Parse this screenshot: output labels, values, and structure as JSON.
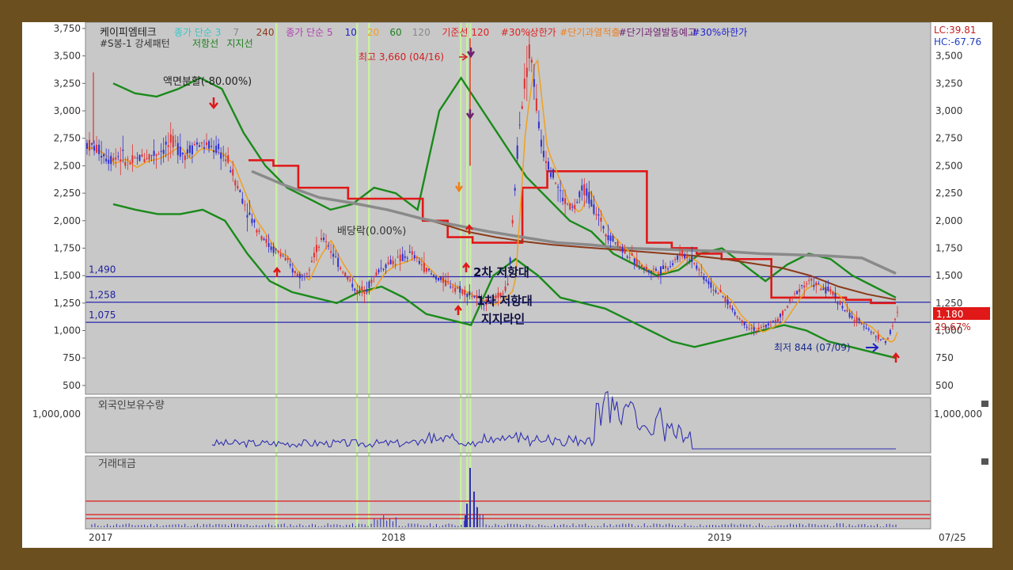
{
  "stock_name": "케이피엠테크",
  "legend_row1": [
    {
      "text": "종가 단순 3",
      "color": "#35c7c7"
    },
    {
      "text": "7",
      "color": "#888888"
    },
    {
      "text": "",
      "color": "#cccccc"
    },
    {
      "text": "240",
      "color": "#8b3a1a"
    },
    {
      "text": "종가 단순 5",
      "color": "#b040b0"
    },
    {
      "text": "10",
      "color": "#2020d0"
    },
    {
      "text": "20",
      "color": "#f0a020"
    },
    {
      "text": "60",
      "color": "#208020"
    },
    {
      "text": "120",
      "color": "#888888"
    },
    {
      "text": "기준선 120",
      "color": "#e02020"
    },
    {
      "text": "#30%상한가",
      "color": "#e02020"
    },
    {
      "text": "#단기과열적출",
      "color": "#f08020"
    },
    {
      "text": "#단기과열발동예고",
      "color": "#702070"
    },
    {
      "text": "#30%하한가",
      "color": "#2020d0"
    }
  ],
  "legend_row2": [
    {
      "text": "#S봉-1 강세패턴",
      "color": "#333333"
    },
    {
      "text": "저항선",
      "color": "#208020"
    },
    {
      "text": "지지선",
      "color": "#208020"
    }
  ],
  "lc_label": "LC:39.81",
  "hc_label": "HC:-67.76",
  "price_label": "1,180",
  "pct_label": "29.67%",
  "annotations": {
    "high": "최고 3,660 (04/16)",
    "low": "최저 844 (07/09)",
    "split": "액면분할(-80.00%)",
    "dividend": "배당락(0.00%)",
    "resist2": "2차 저항대",
    "resist1": "1차 저항대",
    "support": "지지라인"
  },
  "hlines": [
    {
      "label": "1,490",
      "value": 1490
    },
    {
      "label": "1,258",
      "value": 1258
    },
    {
      "label": "1,075",
      "value": 1075
    }
  ],
  "panel2_title": "외국인보유수량",
  "panel3_title": "거래대금",
  "x_labels": [
    {
      "label": "2017"
    },
    {
      "label": "2018"
    },
    {
      "label": "2019"
    },
    {
      "label": "07/25"
    }
  ],
  "colors": {
    "background": "#c8c8c8",
    "candle": "#3030d0",
    "candle_up": "#e03030",
    "resist_green": "#1a8a1a",
    "red_line": "#e01818",
    "ma_gray": "#8a8a8a",
    "ma_brown": "#8b3a1a",
    "ma_orange": "#f0a020",
    "hline": "#2828b0",
    "vline": "#c8f0a0",
    "accent_red": "#e01818"
  },
  "chart_data": [
    {
      "type": "candlestick",
      "title": "케이피엠테크",
      "x_range": [
        "2017",
        "07/25"
      ],
      "ylim": [
        500,
        3750
      ],
      "y_ticks": [
        500,
        750,
        1000,
        1250,
        1500,
        1750,
        2000,
        2250,
        2500,
        2750,
        3000,
        3250,
        3500,
        3750
      ],
      "y_tick_labels": [
        "500",
        "750",
        "1,000",
        "1,250",
        "1,500",
        "1,750",
        "2,000",
        "2,250",
        "2,500",
        "2,750",
        "3,000",
        "3,250",
        "3,500",
        "3,750"
      ],
      "close_path": [
        2700,
        2650,
        2560,
        2600,
        2520,
        2580,
        2600,
        2650,
        2720,
        2600,
        2700,
        2680,
        2650,
        2550,
        2300,
        2050,
        1900,
        1750,
        1700,
        1550,
        1480,
        1700,
        1850,
        1650,
        1500,
        1350,
        1400,
        1550,
        1620,
        1650,
        1700,
        1600,
        1500,
        1450,
        1400,
        1350,
        1300,
        1250,
        1300,
        1400,
        2900,
        3600,
        2700,
        2450,
        2200,
        2100,
        2300,
        2100,
        1900,
        1800,
        1700,
        1600,
        1550,
        1550,
        1600,
        1700,
        1650,
        1500,
        1380,
        1300,
        1150,
        1050,
        1000,
        1050,
        1100,
        1250,
        1400,
        1450,
        1380,
        1350,
        1200,
        1100,
        1050,
        950,
        900,
        1150
      ],
      "ma120_path": [
        2450,
        2320,
        2210,
        2160,
        2100,
        2020,
        1960,
        1900,
        1850,
        1800,
        1780,
        1750,
        1740,
        1730,
        1720,
        1700,
        1690,
        1680,
        1660,
        1520
      ],
      "ma240_path": [
        2050,
        1980,
        1900,
        1850,
        1810,
        1780,
        1760,
        1740,
        1720,
        1700,
        1680,
        1650,
        1610,
        1570,
        1500,
        1400,
        1330,
        1280
      ],
      "resistance_path": [
        3250,
        3160,
        3130,
        3200,
        3300,
        3200,
        2800,
        2500,
        2300,
        2200,
        2100,
        2150,
        2300,
        2250,
        2100,
        3000,
        3300,
        3000,
        2700,
        2400,
        2200,
        2000,
        1900,
        1700,
        1600,
        1500,
        1550,
        1700,
        1750,
        1600,
        1450,
        1600,
        1700,
        1650,
        1500,
        1400,
        1300
      ],
      "support_path": [
        2150,
        2100,
        2060,
        2060,
        2100,
        2000,
        1700,
        1450,
        1350,
        1300,
        1250,
        1350,
        1400,
        1300,
        1150,
        1100,
        1050,
        1500,
        1650,
        1500,
        1300,
        1250,
        1200,
        1100,
        1000,
        900,
        850,
        900,
        950,
        1000,
        1050,
        1000,
        900,
        850,
        800,
        750
      ],
      "baseline_path": [
        2550,
        2500,
        2300,
        2300,
        2200,
        2200,
        2200,
        2000,
        1850,
        1800,
        1800,
        2300,
        2450,
        2450,
        2450,
        2450,
        1800,
        1750,
        1700,
        1650,
        1650,
        1300,
        1300,
        1300,
        1280,
        1250,
        1250
      ],
      "events": [
        {
          "label": "최고 3,660 (04/16)",
          "value": 3660
        },
        {
          "label": "최저 844 (07/09)",
          "value": 844
        },
        {
          "label": "액면분할(-80.00%)"
        },
        {
          "label": "배당락(0.00%)"
        }
      ],
      "horizontal_lines": [
        1490,
        1258,
        1075
      ],
      "last_close": 1180,
      "last_change_pct": 29.67
    },
    {
      "type": "line",
      "title": "외국인보유수량",
      "y_ticks": [
        1000000
      ],
      "y_tick_labels": [
        "1,000,000"
      ],
      "values": [
        0,
        5,
        0,
        10,
        0,
        20,
        0,
        30,
        0,
        40,
        0,
        80,
        0,
        15,
        0,
        20,
        0,
        30,
        0,
        60,
        0,
        300,
        0,
        500,
        0,
        850,
        0,
        1000,
        0,
        900,
        0,
        1050,
        0,
        400,
        0
      ]
    },
    {
      "type": "bar",
      "title": "거래대금",
      "values": [
        0,
        5,
        0,
        20,
        0,
        5,
        0,
        10,
        0,
        15,
        0,
        10,
        0,
        20,
        0,
        80,
        0,
        250,
        0,
        100,
        0,
        40,
        0,
        10,
        0,
        5,
        0,
        10,
        0,
        5,
        0,
        3
      ]
    }
  ]
}
